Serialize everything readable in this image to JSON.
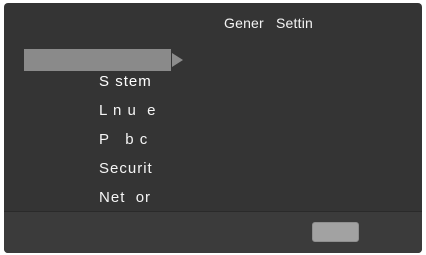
{
  "header": {
    "title": "Gener Settin"
  },
  "menu": {
    "items": [
      {
        "label": "S stem"
      },
      {
        "label": "L n u  e"
      },
      {
        "label": "P   b c"
      },
      {
        "label": "Securit"
      },
      {
        "label": "Net  or"
      }
    ]
  },
  "colors": {
    "background": "#343434",
    "selected": "#8a8a8a",
    "bottom_bar": "#3b3b3b",
    "button": "#a2a2a2"
  },
  "icons": {
    "selection_marker": "triangle-right-icon"
  }
}
